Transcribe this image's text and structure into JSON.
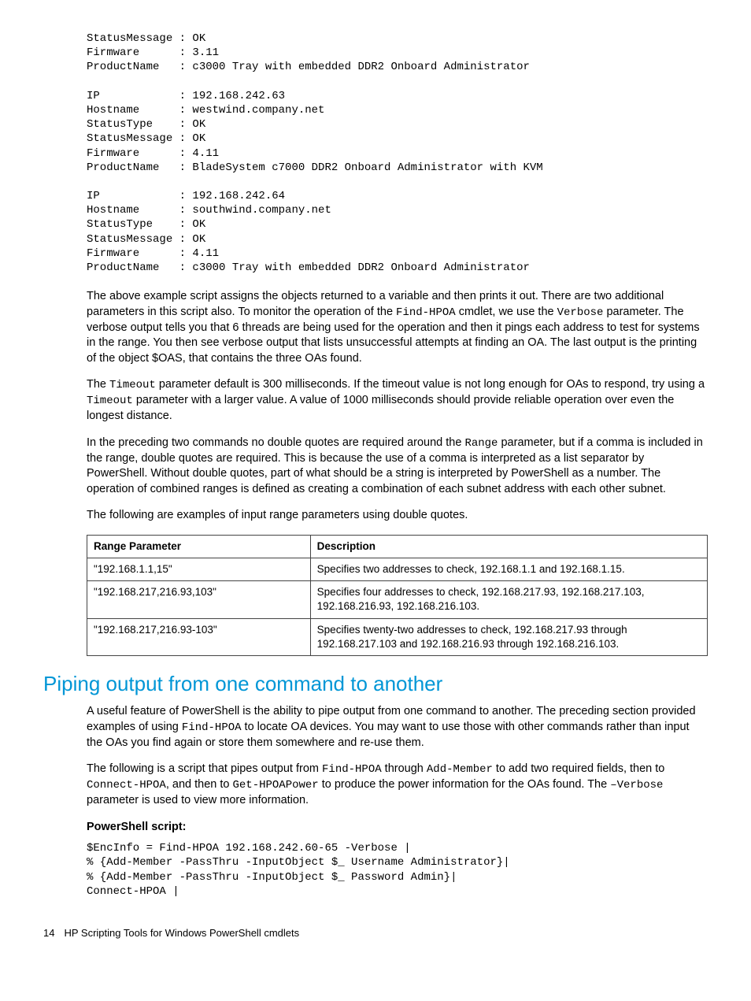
{
  "code_block1": "StatusMessage : OK\nFirmware      : 3.11\nProductName   : c3000 Tray with embedded DDR2 Onboard Administrator\n\nIP            : 192.168.242.63\nHostname      : westwind.company.net\nStatusType    : OK\nStatusMessage : OK\nFirmware      : 4.11\nProductName   : BladeSystem c7000 DDR2 Onboard Administrator with KVM\n\nIP            : 192.168.242.64\nHostname      : southwind.company.net\nStatusType    : OK\nStatusMessage : OK\nFirmware      : 4.11\nProductName   : c3000 Tray with embedded DDR2 Onboard Administrator",
  "para1_a": "The above example script assigns the objects returned to a variable and then prints it out. There are two additional parameters in this script also. To monitor the operation of the ",
  "para1_code1": "Find-HPOA",
  "para1_b": " cmdlet, we use the ",
  "para1_code2": "Verbose",
  "para1_c": " parameter. The verbose output tells you that 6 threads are being used for the operation and then it pings each address to test for systems in the range. You then see verbose output that lists unsuccessful attempts at finding an OA. The last output is the printing of the object $OAS, that contains the three OAs found.",
  "para2_a": "The ",
  "para2_code1": "Timeout",
  "para2_b": " parameter default is 300 milliseconds. If the timeout value is not long enough for OAs to respond, try using a ",
  "para2_code2": "Timeout",
  "para2_c": " parameter with a larger value. A value of 1000 milliseconds should provide reliable operation over even the longest distance.",
  "para3_a": "In the preceding two commands no double quotes are required around the ",
  "para3_code1": "Range",
  "para3_b": " parameter, but if a comma is included in the range, double quotes are required. This is because the use of a comma is interpreted as a list separator by PowerShell. Without double quotes, part of what should be a string is interpreted by PowerShell as a number. The operation of combined ranges is defined as creating a combination of each subnet address with each other subnet.",
  "para4": "The following are examples of input range parameters using double quotes.",
  "table": {
    "headers": [
      "Range Parameter",
      "Description"
    ],
    "rows": [
      [
        "\"192.168.1.1,15\"",
        "Specifies two addresses to check, 192.168.1.1 and 192.168.1.15."
      ],
      [
        "\"192.168.217,216.93,103\"",
        "Specifies four addresses to check, 192.168.217.93, 192.168.217.103, 192.168.216.93, 192.168.216.103."
      ],
      [
        "\"192.168.217,216.93-103\"",
        "Specifies twenty-two addresses to check, 192.168.217.93 through 192.168.217.103 and 192.168.216.93 through 192.168.216.103."
      ]
    ]
  },
  "section_heading": "Piping output from one command to another",
  "para5_a": "A useful feature of PowerShell is the ability to pipe output from one command to another. The preceding section provided examples of using ",
  "para5_code1": "Find-HPOA",
  "para5_b": " to locate OA devices. You may want to use those with other commands rather than input the OAs you find again or store them somewhere and re-use them.",
  "para6_a": "The following is a script that pipes output from ",
  "para6_code1": "Find-HPOA",
  "para6_b": " through ",
  "para6_code2": "Add-Member",
  "para6_c": " to add two required fields, then to ",
  "para6_code3": "Connect-HPOA",
  "para6_d": ", and then to ",
  "para6_code4": "Get-HPOAPower",
  "para6_e": " to produce the power information for the OAs found. The ",
  "para6_code5": "–Verbose",
  "para6_f": " parameter is used to view more information.",
  "script_label": "PowerShell script:",
  "code_block2": "$EncInfo = Find-HPOA 192.168.242.60-65 -Verbose |\n% {Add-Member -PassThru -InputObject $_ Username Administrator}|\n% {Add-Member -PassThru -InputObject $_ Password Admin}|\nConnect-HPOA |",
  "footer_page": "14",
  "footer_text": "HP Scripting Tools for Windows PowerShell cmdlets"
}
